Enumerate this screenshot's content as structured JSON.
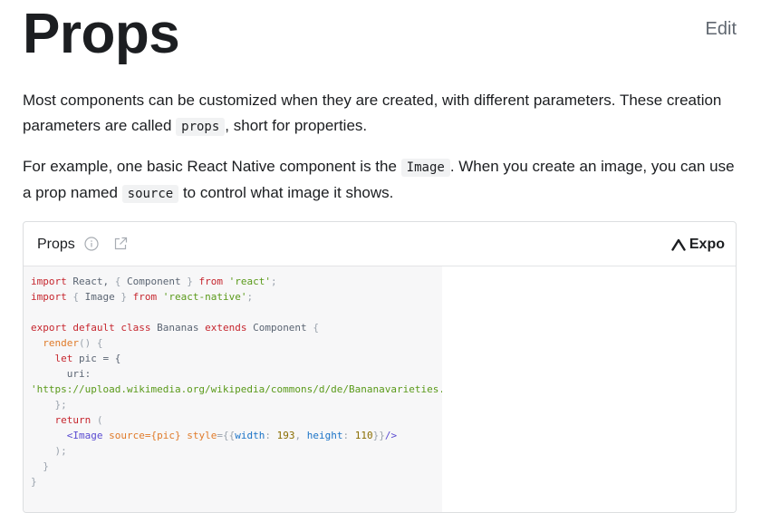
{
  "page": {
    "title": "Props",
    "edit_label": "Edit"
  },
  "intro": {
    "p1_before": "Most components can be customized when they are created, with different parameters. These creation parameters are called ",
    "p1_code": "props",
    "p1_after": ", short for properties.",
    "p2_before": "For example, one basic React Native component is the ",
    "p2_code1": "Image",
    "p2_middle": ". When you create an image, you can use a prop named ",
    "p2_code2": "source",
    "p2_after": " to control what image it shows."
  },
  "snack": {
    "title": "Props",
    "brand": "Expo",
    "icons": {
      "info": "info-icon",
      "open_external": "external-link-icon",
      "brand_logo": "expo-logo-icon"
    },
    "code": {
      "l1_kw1": "import",
      "l1_id": " React, ",
      "l1_p1": "{",
      "l1_id2": " Component ",
      "l1_p2": "}",
      "l1_from": " from ",
      "l1_str": "'react'",
      "l1_end": ";",
      "l2_kw1": "import",
      "l2_p1": " { ",
      "l2_id": "Image",
      "l2_p2": " } ",
      "l2_from": "from ",
      "l2_str": "'react-native'",
      "l2_end": ";",
      "l4_export": "export",
      "l4_default": " default",
      "l4_class": " class",
      "l4_name": " Bananas ",
      "l4_extends": "extends",
      "l4_comp": " Component ",
      "l4_brace": "{",
      "l5_fn": "render",
      "l5_rest": "() {",
      "l6_let": "let",
      "l6_rest": " pic = {",
      "l7_key": "uri:",
      "l8_str": "'https://upload.wikimedia.org/wikipedia/commons/d/de/Bananavarieties.jpg'",
      "l9_close": "};",
      "l10_return": "return",
      "l10_paren": " (",
      "l11_open": "<Image",
      "l11_src": " source",
      "l11_srcval": "={pic}",
      "l11_style": " style",
      "l11_eq": "={{",
      "l11_w": "width",
      "l11_colon1": ": ",
      "l11_wv": "193",
      "l11_comma": ", ",
      "l11_h": "height",
      "l11_colon2": ": ",
      "l11_hv": "110",
      "l11_close1": "}}",
      "l11_close2": "/>",
      "l12": ");",
      "l13": "}",
      "l14": "}"
    },
    "colors": {
      "keyword": "#c6262e",
      "string": "#5a9a1a",
      "function": "#e07b2a",
      "property": "#1a73c7"
    }
  }
}
